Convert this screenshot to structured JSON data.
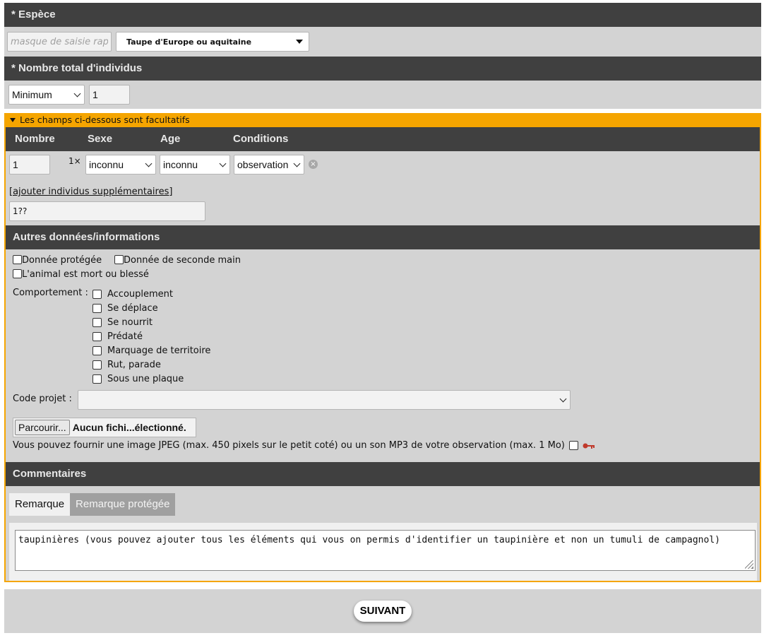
{
  "espece": {
    "header": "* Espèce",
    "quick_input_placeholder": "masque de saisie rapide",
    "selected": "Taupe d'Europe ou aquitaine"
  },
  "nombre_total": {
    "header": "* Nombre total d'individus",
    "mode": "Minimum",
    "value": "1"
  },
  "optional": {
    "toggle_label": "Les champs ci-dessous sont facultatifs",
    "columns": [
      "Nombre",
      "Sexe",
      "Age",
      "Conditions"
    ],
    "individual": {
      "count": "1",
      "multiplier": "1×",
      "sexe": "inconnu",
      "age": "inconnu",
      "conditions": "observation"
    },
    "add_link": "[ajouter individus supplémentaires]",
    "summary": "1??"
  },
  "autres": {
    "header": "Autres données/informations",
    "donnee_protegee": "Donnée protégée",
    "seconde_main": "Donnée de seconde main",
    "animal_mort": "L'animal est mort ou blessé",
    "comportement_label": "Comportement :",
    "comportements": [
      "Accouplement",
      "Se déplace",
      "Se nourrit",
      "Prédaté",
      "Marquage de territoire",
      "Rut, parade",
      "Sous une plaque"
    ],
    "code_projet_label": "Code projet :",
    "code_projet_value": "",
    "browse_button": "Parcourir...",
    "file_status": "Aucun fichi...électionné.",
    "file_hint": "Vous pouvez fournir une image JPEG (max. 450 pixels sur le petit coté) ou un son MP3 de votre observation (max. 1 Mo)"
  },
  "commentaires": {
    "header": "Commentaires",
    "tabs": [
      "Remarque",
      "Remarque protégée"
    ],
    "text": "taupinières (vous pouvez ajouter tous les éléments qui vous on permis d'identifier un taupinière et non un tumuli de campagnol)"
  },
  "footer": {
    "next_button": "SUIVANT"
  },
  "colors": {
    "header_bg": "#404040",
    "panel_bg": "#d3d3d3",
    "accent_orange": "#f5a500"
  },
  "icons": [
    "dropdown-arrow-icon",
    "chevron-down-icon",
    "remove-circle-icon",
    "key-icon",
    "resize-grip-icon"
  ]
}
